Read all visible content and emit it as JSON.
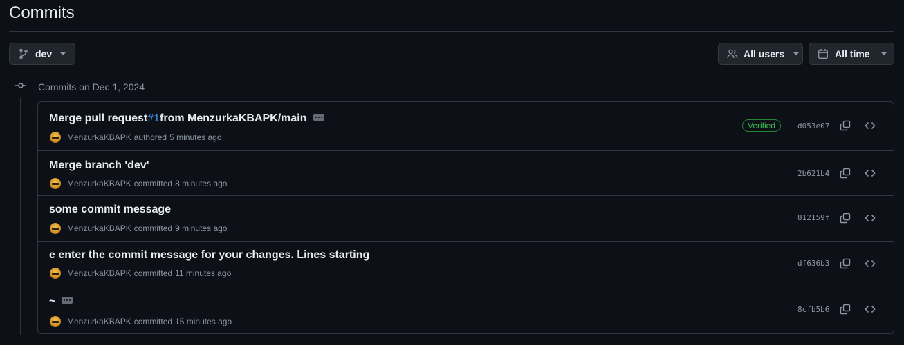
{
  "page": {
    "title": "Commits"
  },
  "filters": {
    "branch": {
      "label": "dev",
      "icon": "git-branch-icon"
    },
    "users": {
      "label": "All users",
      "icon": "people-icon"
    },
    "time": {
      "label": "All time",
      "icon": "calendar-icon"
    }
  },
  "group": {
    "label": "Commits on Dec 1, 2024",
    "icon": "git-commit-icon"
  },
  "commits": [
    {
      "message_prefix": "Merge pull request ",
      "pr_link": "#1",
      "message_suffix": " from MenzurkaKBAPK/main",
      "author": "MenzurkaKBAPK",
      "action": "authored",
      "time": "5 minutes ago",
      "badge": "Verified",
      "sha": "d053e07"
    },
    {
      "message": "Merge branch 'dev'",
      "author": "MenzurkaKBAPK",
      "action": "committed",
      "time": "8 minutes ago",
      "sha": "2b621b4"
    },
    {
      "message": "some commit message",
      "author": "MenzurkaKBAPK",
      "action": "committed",
      "time": "9 minutes ago",
      "sha": "812159f"
    },
    {
      "message": "e enter the commit message for your changes. Lines starting",
      "author": "MenzurkaKBAPK",
      "action": "committed",
      "time": "11 minutes ago",
      "sha": "df636b3"
    },
    {
      "message": "~",
      "author": "MenzurkaKBAPK",
      "action": "committed",
      "time": "15 minutes ago",
      "sha": "8cfb5b6"
    }
  ],
  "colors": {
    "background": "#0d1117",
    "border": "#30363d",
    "text": "#e6edf3",
    "muted": "#8d96a0",
    "link": "#4493f8",
    "verified": "#3fb950"
  }
}
